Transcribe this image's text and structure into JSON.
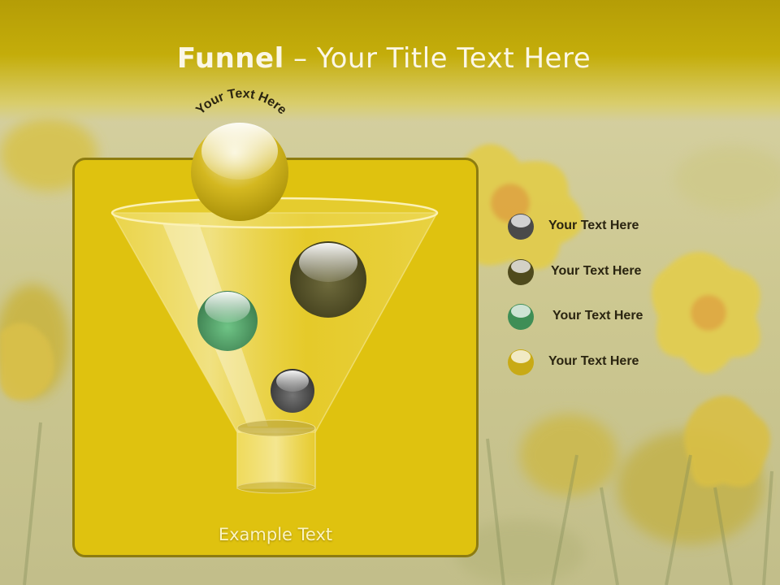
{
  "slide": {
    "title_bold": "Funnel",
    "title_rest": " – Your Title Text Here",
    "arc_text": "Your Text Here",
    "example_text": "Example Text"
  },
  "legend": [
    {
      "label": "Your  Text Here",
      "color": "#4a4a4a"
    },
    {
      "label": "Your  Text Here",
      "color": "#4f4a1c"
    },
    {
      "label": "Your  Text Here",
      "color": "#3f8e56"
    },
    {
      "label": "Your  Text Here",
      "color": "#c8aa16"
    }
  ],
  "colors": {
    "title_band": "#c4ad0a",
    "panel": "#dfc20f",
    "panel_border": "#8d7c10",
    "title_text": "#fbf7e6",
    "legend_text": "#2a2410"
  }
}
